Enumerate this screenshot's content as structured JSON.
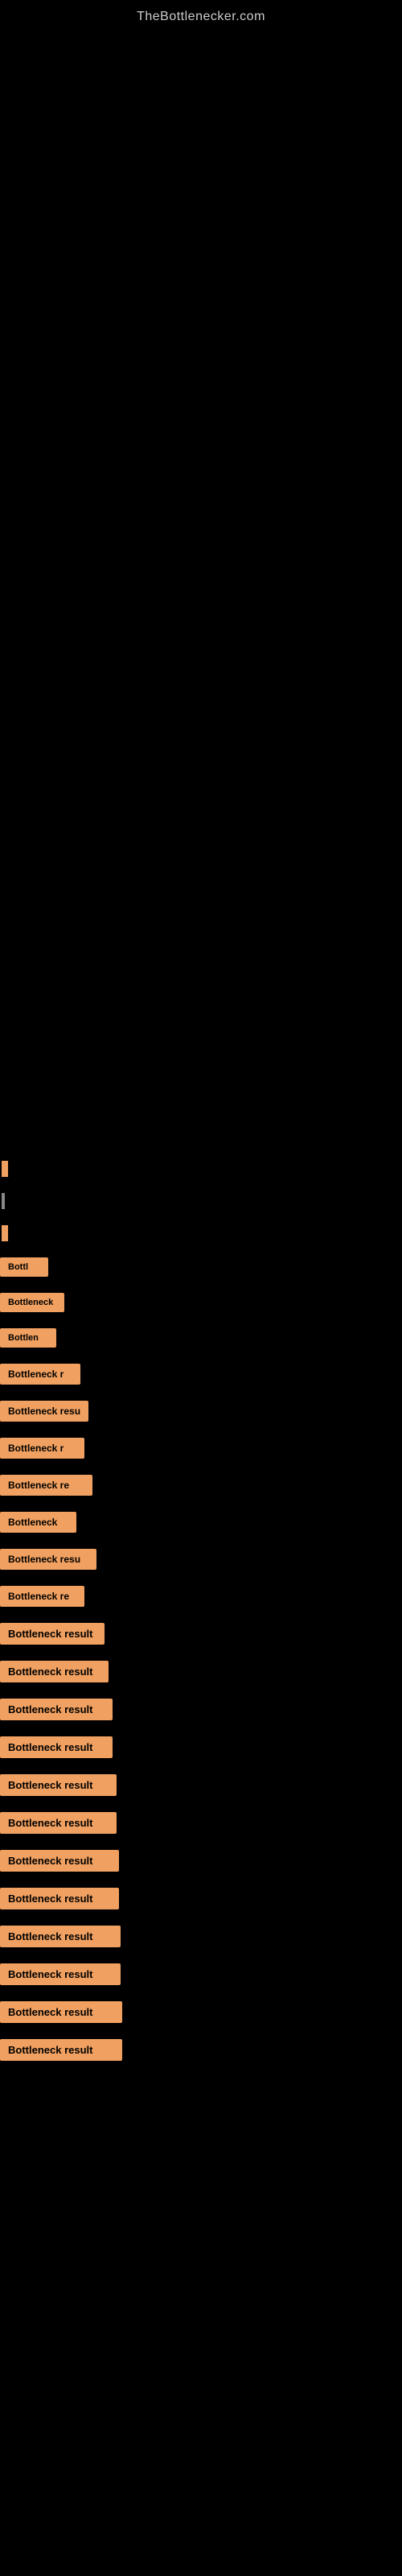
{
  "site": {
    "title": "TheBottlenecker.com"
  },
  "results": {
    "items": [
      {
        "id": 1,
        "label": "Bottl",
        "class": "item-1"
      },
      {
        "id": 2,
        "label": "Bottleneck",
        "class": "item-2"
      },
      {
        "id": 3,
        "label": "Bottlen",
        "class": "item-3"
      },
      {
        "id": 4,
        "label": "Bottleneck r",
        "class": "item-4"
      },
      {
        "id": 5,
        "label": "Bottleneck resu",
        "class": "item-5"
      },
      {
        "id": 6,
        "label": "Bottleneck r",
        "class": "item-6"
      },
      {
        "id": 7,
        "label": "Bottleneck re",
        "class": "item-7"
      },
      {
        "id": 8,
        "label": "Bottleneck",
        "class": "item-8"
      },
      {
        "id": 9,
        "label": "Bottleneck resu",
        "class": "item-9"
      },
      {
        "id": 10,
        "label": "Bottleneck re",
        "class": "item-10"
      },
      {
        "id": 11,
        "label": "Bottleneck result",
        "class": "item-11"
      },
      {
        "id": 12,
        "label": "Bottleneck result",
        "class": "item-12"
      },
      {
        "id": 13,
        "label": "Bottleneck result",
        "class": "item-13"
      },
      {
        "id": 14,
        "label": "Bottleneck result",
        "class": "item-14"
      },
      {
        "id": 15,
        "label": "Bottleneck result",
        "class": "item-15"
      },
      {
        "id": 16,
        "label": "Bottleneck result",
        "class": "item-16"
      },
      {
        "id": 17,
        "label": "Bottleneck result",
        "class": "item-17"
      },
      {
        "id": 18,
        "label": "Bottleneck result",
        "class": "item-18"
      },
      {
        "id": 19,
        "label": "Bottleneck result",
        "class": "item-19"
      },
      {
        "id": 20,
        "label": "Bottleneck result",
        "class": "item-20"
      },
      {
        "id": 21,
        "label": "Bottleneck result",
        "class": "item-21"
      },
      {
        "id": 22,
        "label": "Bottleneck result",
        "class": "item-22"
      }
    ]
  }
}
